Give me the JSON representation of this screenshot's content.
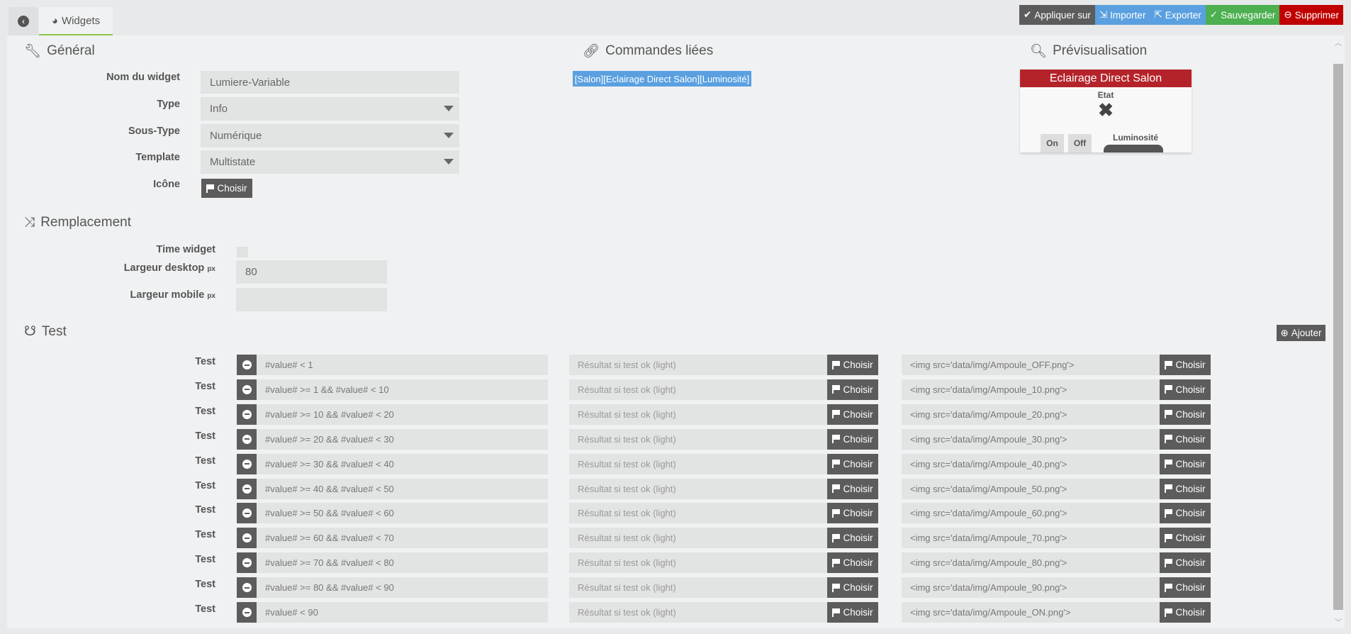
{
  "tabs": {
    "back_icon": "arrow-circle-left-icon",
    "widgets_label": "Widgets"
  },
  "actions": [
    {
      "label": "Appliquer sur",
      "icon": "check-double-icon",
      "color": "#5c5c5c",
      "glyph": "✔"
    },
    {
      "label": "Importer",
      "icon": "file-import-icon",
      "color": "#5aa0e0",
      "glyph": "⇲"
    },
    {
      "label": "Exporter",
      "icon": "file-export-icon",
      "color": "#5aa0e0",
      "glyph": "⇱"
    },
    {
      "label": "Sauvegarder",
      "icon": "check-circle-icon",
      "color": "#4caf50",
      "glyph": "✓"
    },
    {
      "label": "Supprimer",
      "icon": "minus-circle-icon",
      "color": "#c00000",
      "glyph": "⊖"
    }
  ],
  "general": {
    "title": "Général",
    "name_label": "Nom du widget",
    "name_value": "Lumiere-Variable",
    "type_label": "Type",
    "type_value": "Info",
    "subtype_label": "Sous-Type",
    "subtype_value": "Numérique",
    "template_label": "Template",
    "template_value": "Multistate",
    "icon_label": "Icône",
    "choose": "Choisir"
  },
  "commands": {
    "title": "Commandes liées",
    "linked": "[Salon][Eclairage Direct Salon][Luminosité]"
  },
  "preview": {
    "title": "Prévisualisation",
    "widget_title": "Eclairage Direct Salon",
    "state_label": "Etat",
    "on": "On",
    "off": "Off",
    "lum_label": "Luminosité"
  },
  "replacement": {
    "title": "Remplacement",
    "time_label": "Time widget",
    "desktop_label": "Largeur desktop",
    "desktop_value": "80",
    "mobile_label": "Largeur mobile",
    "mobile_value": "",
    "unit": "px"
  },
  "test": {
    "title": "Test",
    "add": "Ajouter",
    "row_label": "Test",
    "choose": "Choisir",
    "result_placeholder": "Résultat si test ok (light)",
    "rows": [
      {
        "cond": "#value# < 1",
        "img": "<img src='data/img/Ampoule_OFF.png'>"
      },
      {
        "cond": "#value# >= 1 && #value# < 10",
        "img": "<img src='data/img/Ampoule_10.png'>"
      },
      {
        "cond": "#value# >= 10 && #value# < 20",
        "img": "<img src='data/img/Ampoule_20.png'>"
      },
      {
        "cond": "#value# >= 20 && #value# < 30",
        "img": "<img src='data/img/Ampoule_30.png'>"
      },
      {
        "cond": "#value# >= 30 && #value# < 40",
        "img": "<img src='data/img/Ampoule_40.png'>"
      },
      {
        "cond": "#value# >= 40 && #value# < 50",
        "img": "<img src='data/img/Ampoule_50.png'>"
      },
      {
        "cond": "#value# >= 50 && #value# < 60",
        "img": "<img src='data/img/Ampoule_60.png'>"
      },
      {
        "cond": "#value# >= 60 && #value# < 70",
        "img": "<img src='data/img/Ampoule_70.png'>"
      },
      {
        "cond": "#value# >= 70 && #value# < 80",
        "img": "<img src='data/img/Ampoule_80.png'>"
      },
      {
        "cond": "#value# >= 80 && #value# < 90",
        "img": "<img src='data/img/Ampoule_90.png'>"
      },
      {
        "cond": "#value# < 90",
        "img": "<img src='data/img/Ampoule_ON.png'>"
      }
    ]
  }
}
